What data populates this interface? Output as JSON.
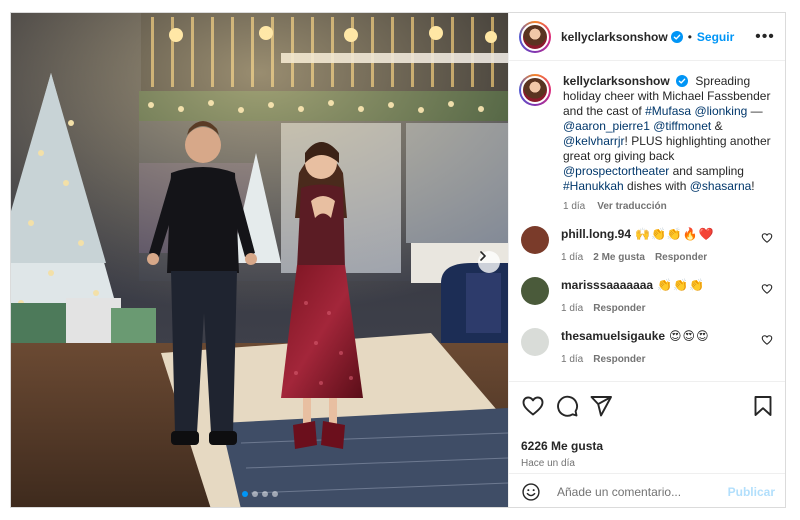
{
  "post": {
    "username": "kellyclarksonshow",
    "follow_label": "Seguir",
    "separator": "•",
    "more_label": "•••"
  },
  "caption": {
    "username": "kellyclarksonshow",
    "segments": [
      {
        "t": "Spreading holiday cheer with Michael Fassbender and the cast of ",
        "tag": false
      },
      {
        "t": "#Mufasa",
        "tag": true
      },
      {
        "t": " ",
        "tag": false
      },
      {
        "t": "@lionking",
        "tag": true
      },
      {
        "t": " — ",
        "tag": false
      },
      {
        "t": "@aaron_pierre1",
        "tag": true
      },
      {
        "t": " ",
        "tag": false
      },
      {
        "t": "@tiffmonet",
        "tag": true
      },
      {
        "t": " & ",
        "tag": false
      },
      {
        "t": "@kelvharrjr",
        "tag": true
      },
      {
        "t": "! PLUS highlighting another great org giving back ",
        "tag": false
      },
      {
        "t": "@prospectortheater",
        "tag": true
      },
      {
        "t": " and sampling ",
        "tag": false
      },
      {
        "t": "#Hanukkah",
        "tag": true
      },
      {
        "t": " dishes with ",
        "tag": false
      },
      {
        "t": "@shasarna",
        "tag": true
      },
      {
        "t": "!",
        "tag": false
      }
    ],
    "time": "1 día",
    "translate_label": "Ver traducción"
  },
  "comments": [
    {
      "user": "phill.long.94",
      "text": "🙌👏👏🔥❤️",
      "time": "1 día",
      "likes": "2 Me gusta",
      "reply": "Responder",
      "avatar_color": "#7a3b2a"
    },
    {
      "user": "marisssaaaaaaa",
      "text": "👏👏👏",
      "time": "1 día",
      "likes": "",
      "reply": "Responder",
      "avatar_color": "#4a5a3a"
    },
    {
      "user": "thesamuelsigauke",
      "text": "😍😍😍",
      "time": "1 día",
      "likes": "",
      "reply": "Responder",
      "avatar_color": "#d9dcd8"
    }
  ],
  "stats": {
    "likes": "6226 Me gusta",
    "posted": "Hace un día"
  },
  "composer": {
    "placeholder": "Añade un comentario...",
    "publish_label": "Publicar"
  },
  "colors": {
    "accent": "#0095f6",
    "link": "#00376b",
    "publish_disabled": "#b2dffc",
    "secondary_text": "#737373"
  },
  "carousel": {
    "total": 4,
    "current": 1
  },
  "icons": [
    "verified-badge-icon",
    "more-options-icon",
    "heart-icon",
    "comment-icon",
    "share-icon",
    "bookmark-icon",
    "emoji-icon",
    "chevron-right-icon"
  ]
}
